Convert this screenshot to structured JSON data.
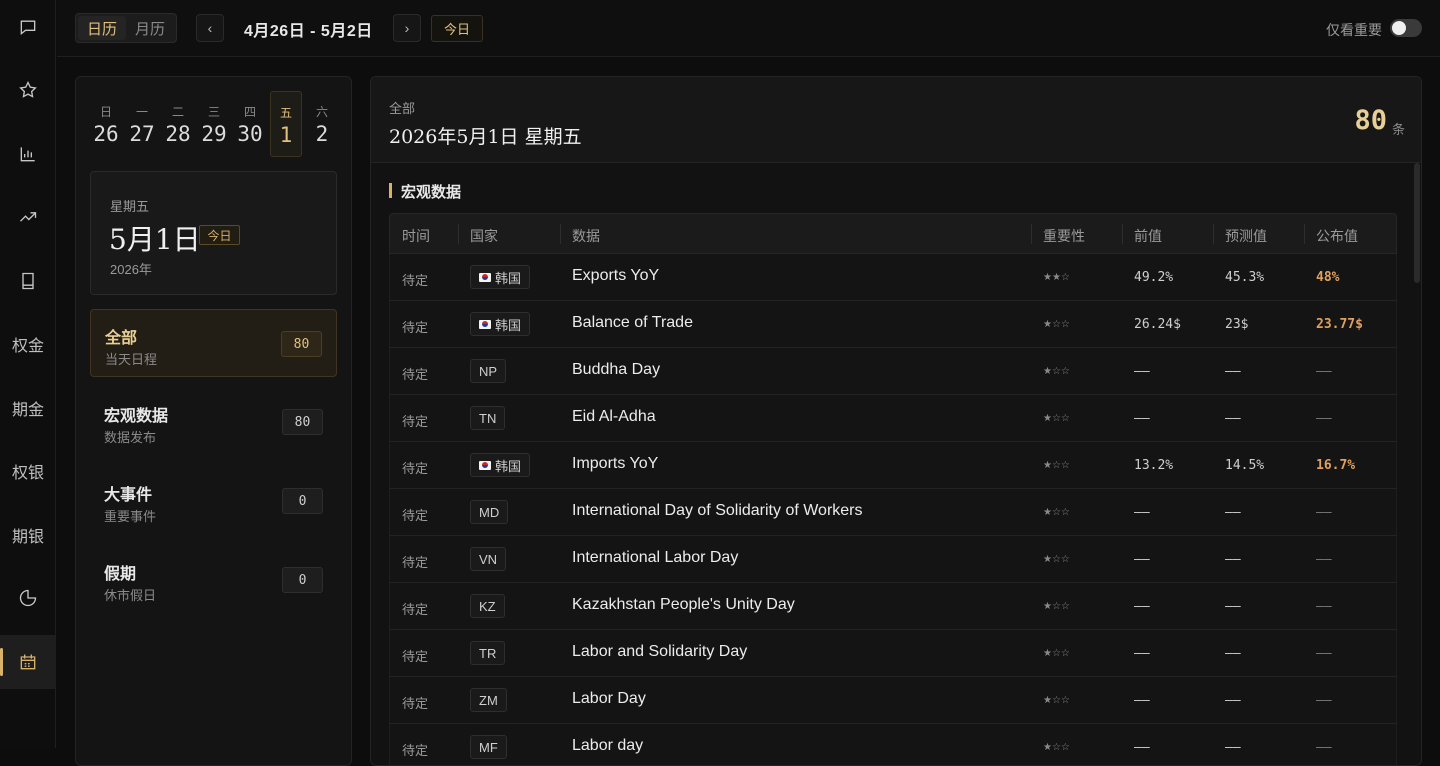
{
  "rail": {
    "items": [
      {
        "name": "chat-icon",
        "label": ""
      },
      {
        "name": "star-icon",
        "label": ""
      },
      {
        "name": "chart-icon",
        "label": ""
      },
      {
        "name": "trend-icon",
        "label": ""
      },
      {
        "name": "book-icon",
        "label": ""
      },
      {
        "name": "rail-item-quanjin",
        "label": "权金"
      },
      {
        "name": "rail-item-qijin",
        "label": "期金"
      },
      {
        "name": "rail-item-quanyin",
        "label": "权银"
      },
      {
        "name": "rail-item-qiyin",
        "label": "期银"
      },
      {
        "name": "pie-icon",
        "label": ""
      },
      {
        "name": "calendar-icon",
        "label": ""
      }
    ]
  },
  "topbar": {
    "view_day": "日历",
    "view_month": "月历",
    "prev_icon": "‹",
    "next_icon": "›",
    "range": "4月26日 - 5月2日",
    "today": "今日",
    "only_important": "仅看重要"
  },
  "week": [
    {
      "wd": "日",
      "dn": "26"
    },
    {
      "wd": "一",
      "dn": "27"
    },
    {
      "wd": "二",
      "dn": "28"
    },
    {
      "wd": "三",
      "dn": "29"
    },
    {
      "wd": "四",
      "dn": "30"
    },
    {
      "wd": "五",
      "dn": "1"
    },
    {
      "wd": "六",
      "dn": "2"
    }
  ],
  "datecard": {
    "weekday": "星期五",
    "date": "5月1日",
    "badge": "今日",
    "year": "2026年"
  },
  "categories": [
    {
      "title": "全部",
      "sub": "当天日程",
      "count": "80"
    },
    {
      "title": "宏观数据",
      "sub": "数据发布",
      "count": "80"
    },
    {
      "title": "大事件",
      "sub": "重要事件",
      "count": "0"
    },
    {
      "title": "假期",
      "sub": "休市假日",
      "count": "0"
    }
  ],
  "main": {
    "label": "全部",
    "title": "2026年5月1日 星期五",
    "count": "80",
    "unit": "条",
    "section": "宏观数据",
    "columns": [
      "时间",
      "国家",
      "数据",
      "重要性",
      "前值",
      "预测值",
      "公布值"
    ],
    "rows": [
      {
        "time": "待定",
        "flag": true,
        "country": "韩国",
        "name": "Exports YoY",
        "imp": "★★☆",
        "prev": "49.2%",
        "fcst": "45.3%",
        "act": "48%",
        "hl": true
      },
      {
        "time": "待定",
        "flag": true,
        "country": "韩国",
        "name": "Balance of Trade",
        "imp": "★☆☆",
        "prev": "26.24$",
        "fcst": "23$",
        "act": "23.77$",
        "hl": true
      },
      {
        "time": "待定",
        "flag": false,
        "country": "NP",
        "name": "Buddha Day",
        "imp": "★☆☆",
        "prev": "——",
        "fcst": "——",
        "act": "——",
        "hl": false
      },
      {
        "time": "待定",
        "flag": false,
        "country": "TN",
        "name": "Eid Al-Adha",
        "imp": "★☆☆",
        "prev": "——",
        "fcst": "——",
        "act": "——",
        "hl": false
      },
      {
        "time": "待定",
        "flag": true,
        "country": "韩国",
        "name": "Imports YoY",
        "imp": "★☆☆",
        "prev": "13.2%",
        "fcst": "14.5%",
        "act": "16.7%",
        "hl": true
      },
      {
        "time": "待定",
        "flag": false,
        "country": "MD",
        "name": "International Day of Solidarity of Workers",
        "imp": "★☆☆",
        "prev": "——",
        "fcst": "——",
        "act": "——",
        "hl": false
      },
      {
        "time": "待定",
        "flag": false,
        "country": "VN",
        "name": "International Labor Day",
        "imp": "★☆☆",
        "prev": "——",
        "fcst": "——",
        "act": "——",
        "hl": false
      },
      {
        "time": "待定",
        "flag": false,
        "country": "KZ",
        "name": "Kazakhstan People's Unity Day",
        "imp": "★☆☆",
        "prev": "——",
        "fcst": "——",
        "act": "——",
        "hl": false
      },
      {
        "time": "待定",
        "flag": false,
        "country": "TR",
        "name": "Labor and Solidarity Day",
        "imp": "★☆☆",
        "prev": "——",
        "fcst": "——",
        "act": "——",
        "hl": false
      },
      {
        "time": "待定",
        "flag": false,
        "country": "ZM",
        "name": "Labor Day",
        "imp": "★☆☆",
        "prev": "——",
        "fcst": "——",
        "act": "——",
        "hl": false
      },
      {
        "time": "待定",
        "flag": false,
        "country": "MF",
        "name": "Labor day",
        "imp": "★☆☆",
        "prev": "——",
        "fcst": "——",
        "act": "——",
        "hl": false
      }
    ]
  }
}
